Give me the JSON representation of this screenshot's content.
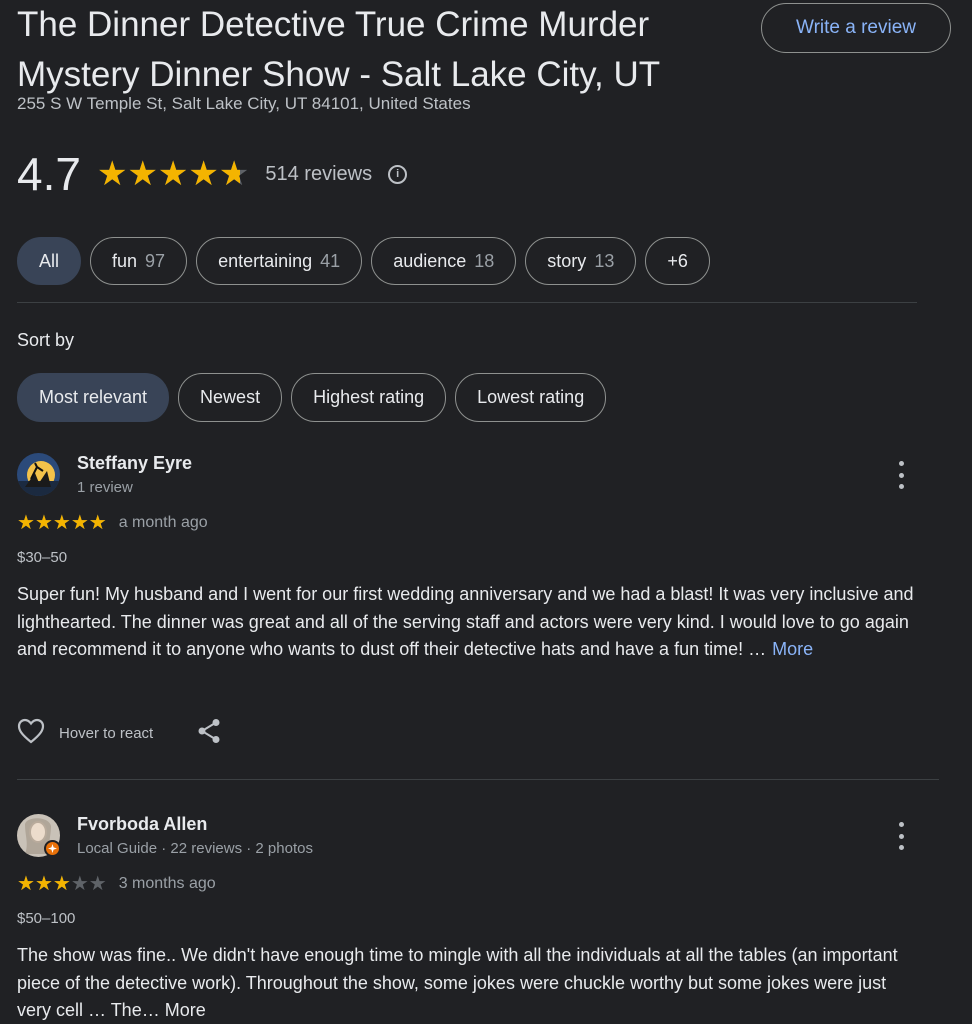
{
  "place": {
    "title": "The Dinner Detective True Crime Murder Mystery Dinner Show - Salt Lake City, UT",
    "address": "255 S W Temple St, Salt Lake City, UT 84101, United States",
    "write_review_label": "Write a review"
  },
  "rating": {
    "value": "4.7",
    "stars": 4.7,
    "reviews_label": "514 reviews",
    "info_glyph": "i"
  },
  "topics": [
    {
      "label": "All",
      "count": "",
      "active": true
    },
    {
      "label": "fun",
      "count": "97",
      "active": false
    },
    {
      "label": "entertaining",
      "count": "41",
      "active": false
    },
    {
      "label": "audience",
      "count": "18",
      "active": false
    },
    {
      "label": "story",
      "count": "13",
      "active": false
    },
    {
      "label": "+6",
      "count": "",
      "active": false
    }
  ],
  "sort": {
    "label": "Sort by",
    "options": [
      {
        "label": "Most relevant",
        "active": true
      },
      {
        "label": "Newest",
        "active": false
      },
      {
        "label": "Highest rating",
        "active": false
      },
      {
        "label": "Lowest rating",
        "active": false
      }
    ]
  },
  "reviews": [
    {
      "name": "Steffany Eyre",
      "meta": "1 review",
      "rating": 5,
      "time": "a month ago",
      "price": "$30–50",
      "text": "Super fun! My husband and I went for our first wedding anniversary and we had a blast! It was very inclusive and lighthearted. The dinner was great and all of the serving staff and actors were very kind. I would love to go again and recommend it to anyone who wants to dust off their detective hats and have a fun time! …",
      "more": "More",
      "react_label": "Hover to react"
    },
    {
      "name": "Fvorboda Allen",
      "meta": "Local Guide · 22 reviews · 2 photos",
      "rating": 3,
      "time": "3 months ago",
      "price": "$50–100",
      "text": "The show was fine.. We didn't have enough time to mingle with all the individuals at all the tables (an important piece of the detective work). Throughout the show, some jokes were chuckle worthy but some jokes were just very cell … The… More",
      "more": "",
      "react_label": ""
    }
  ],
  "colors": {
    "background": "#202124",
    "star": "#f4b400",
    "link": "#8ab4f8",
    "active_chip": "#394457"
  }
}
